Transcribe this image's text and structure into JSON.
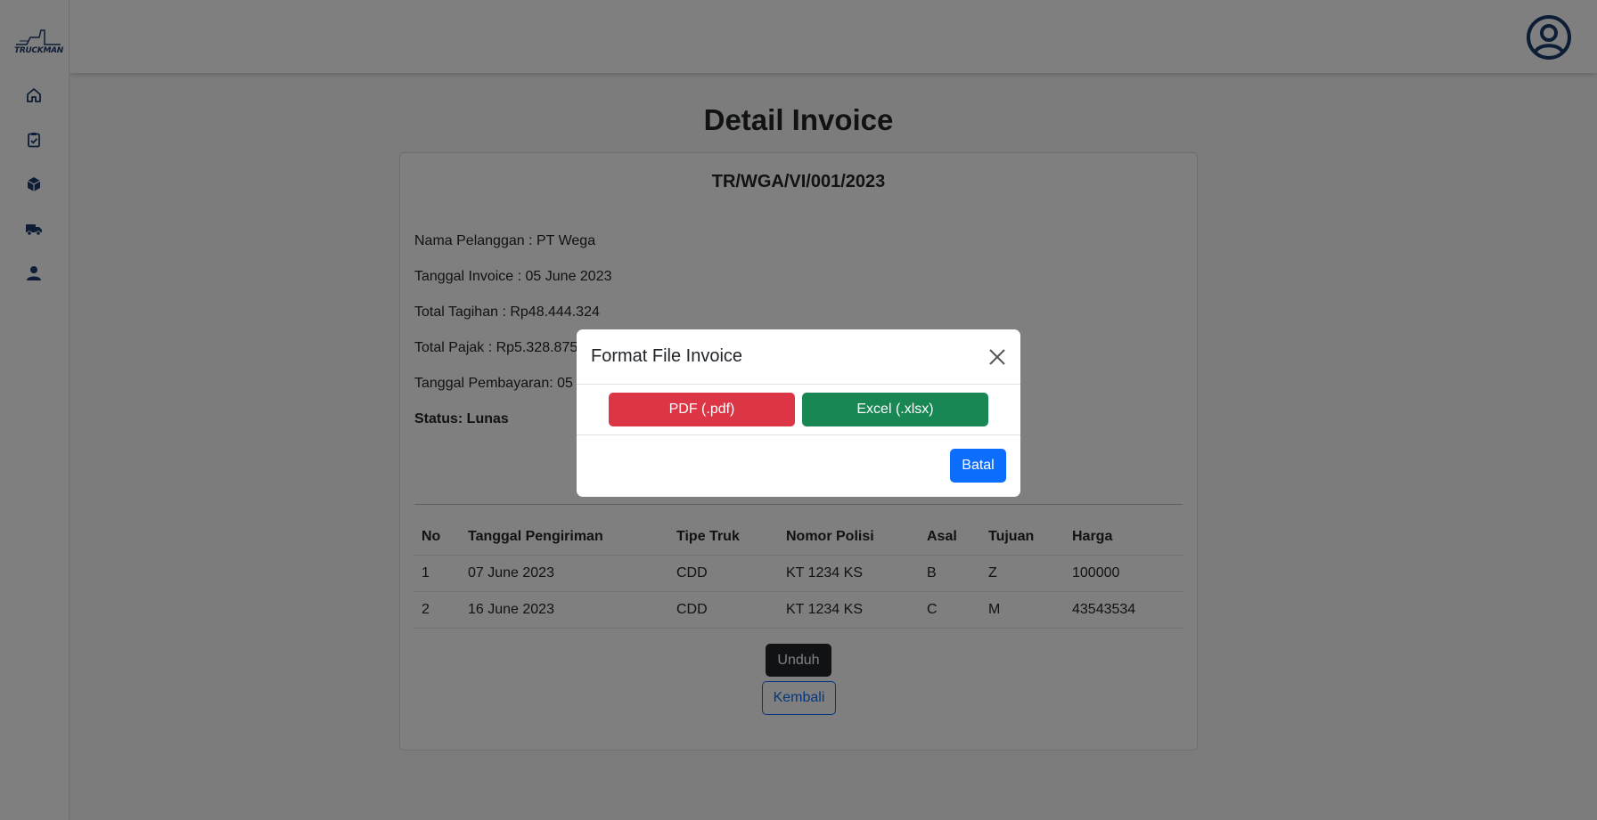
{
  "brand": {
    "logo_text": "TRUCKMAN",
    "color": "#1b3a6b"
  },
  "sidebar": {
    "items": [
      {
        "name": "home",
        "icon": "home-icon"
      },
      {
        "name": "orders",
        "icon": "clipboard-check-icon"
      },
      {
        "name": "packages",
        "icon": "box-icon"
      },
      {
        "name": "trucks",
        "icon": "truck-icon"
      },
      {
        "name": "users",
        "icon": "person-icon"
      }
    ]
  },
  "header": {
    "avatar_icon": "user-circle-icon"
  },
  "page": {
    "title": "Detail Invoice"
  },
  "invoice": {
    "number": "TR/WGA/VI/001/2023",
    "customer": "Nama Pelanggan : PT Wega",
    "date": "Tanggal Invoice : 05 June 2023",
    "total": "Total Tagihan : Rp48.444.324",
    "tax": "Total Pajak : Rp5.328.875",
    "payment_date": "Tanggal Pembayaran: 05",
    "status": "Status: Lunas"
  },
  "table": {
    "headers": [
      "No",
      "Tanggal Pengiriman",
      "Tipe Truk",
      "Nomor Polisi",
      "Asal",
      "Tujuan",
      "Harga"
    ],
    "rows": [
      [
        "1",
        "07 June 2023",
        "CDD",
        "KT 1234 KS",
        "B",
        "Z",
        "100000"
      ],
      [
        "2",
        "16 June 2023",
        "CDD",
        "KT 1234 KS",
        "C",
        "M",
        "43543534"
      ]
    ]
  },
  "actions": {
    "download_label": "Unduh",
    "back_label": "Kembali"
  },
  "modal": {
    "title": "Format File Invoice",
    "pdf_label": "PDF (.pdf)",
    "excel_label": "Excel (.xlsx)",
    "cancel_label": "Batal"
  },
  "colors": {
    "primary": "#0d6efd",
    "danger": "#dc3545",
    "success": "#198754",
    "dark": "#212529"
  }
}
